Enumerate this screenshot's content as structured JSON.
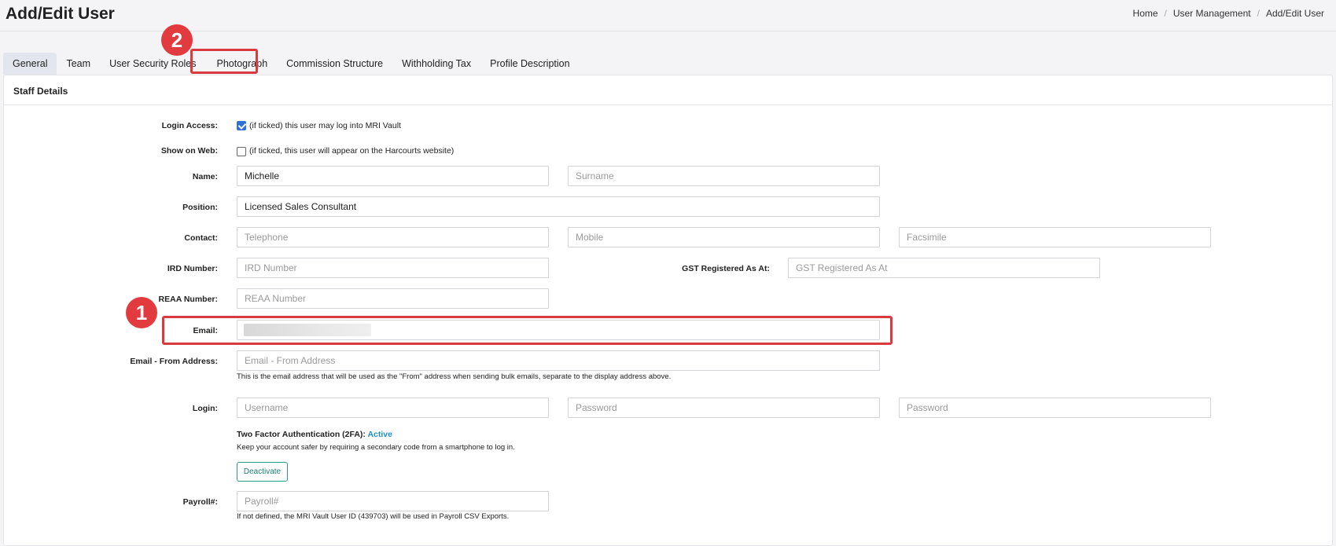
{
  "page_title": "Add/Edit User",
  "breadcrumb": [
    "Home",
    "User Management",
    "Add/Edit User"
  ],
  "tabs": [
    {
      "label": "General",
      "active": true
    },
    {
      "label": "Team"
    },
    {
      "label": "User Security Roles"
    },
    {
      "label": "Photograph"
    },
    {
      "label": "Commission Structure"
    },
    {
      "label": "Withholding Tax"
    },
    {
      "label": "Profile Description"
    }
  ],
  "card_title": "Staff Details",
  "form": {
    "login_access": {
      "label": "Login Access:",
      "checked": true,
      "text": "(if ticked) this user may log into MRI Vault"
    },
    "show_on_web": {
      "label": "Show on Web:",
      "checked": false,
      "text": "(if ticked, this user will appear on the Harcourts website)"
    },
    "name": {
      "label": "Name:",
      "first_value": "Michelle",
      "surname_placeholder": "Surname"
    },
    "position": {
      "label": "Position:",
      "value": "Licensed Sales Consultant"
    },
    "contact": {
      "label": "Contact:",
      "telephone_placeholder": "Telephone",
      "mobile_placeholder": "Mobile",
      "facsimile_placeholder": "Facsimile"
    },
    "ird": {
      "label": "IRD Number:",
      "placeholder": "IRD Number"
    },
    "gst": {
      "label": "GST Registered As At:",
      "placeholder": "GST Registered As At"
    },
    "reaa": {
      "label": "REAA Number:",
      "placeholder": "REAA Number"
    },
    "email": {
      "label": "Email:"
    },
    "email_from": {
      "label": "Email - From Address:",
      "placeholder": "Email - From Address",
      "help": "This is the email address that will be used as the \"From\" address when sending bulk emails, separate to the display address above."
    },
    "login": {
      "label": "Login:",
      "username_placeholder": "Username",
      "password_placeholder": "Password",
      "password2_placeholder": "Password"
    },
    "tfa": {
      "title": "Two Factor Authentication (2FA): ",
      "status": "Active",
      "desc": "Keep your account safer by requiring a secondary code from a smartphone to log in.",
      "button": "Deactivate"
    },
    "payroll": {
      "label": "Payroll#:",
      "placeholder": "Payroll#",
      "help": "If not defined, the MRI Vault User ID (439703) will be used in Payroll CSV Exports."
    }
  },
  "annotations": {
    "badge1": "1",
    "badge2": "2"
  },
  "colors": {
    "accent": "#2f6fd8",
    "highlight": "#d83a3f",
    "tfa_active": "#1f8fc9",
    "button_border": "#2a9d8f"
  }
}
